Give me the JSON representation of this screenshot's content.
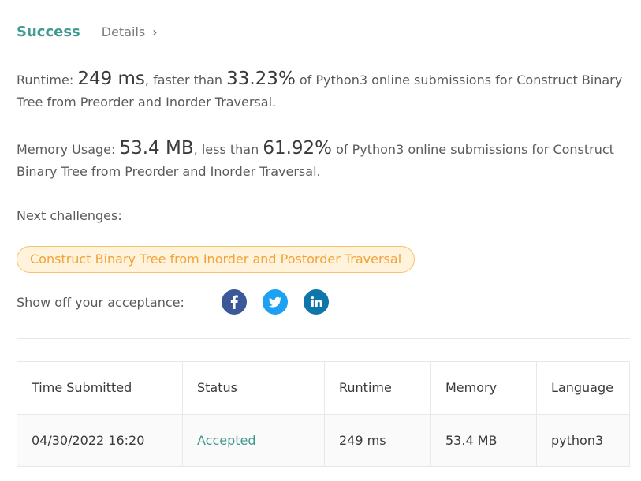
{
  "header": {
    "status": "Success",
    "details_label": "Details",
    "details_chevron": "›"
  },
  "runtime": {
    "label": "Runtime: ",
    "value": "249 ms",
    "comparison_text": ", faster than ",
    "percentile": "33.23%",
    "suffix": " of Python3 online submissions for Construct Binary Tree from Preorder and Inorder Traversal."
  },
  "memory": {
    "label": "Memory Usage: ",
    "value": "53.4 MB",
    "comparison_text": ", less than ",
    "percentile": "61.92%",
    "suffix": " of Python3 online submissions for Construct Binary Tree from Preorder and Inorder Traversal."
  },
  "next_challenges": {
    "label": "Next challenges:",
    "items": [
      "Construct Binary Tree from Inorder and Postorder Traversal"
    ]
  },
  "share": {
    "label": "Show off your acceptance:",
    "icons": [
      {
        "name": "facebook-icon",
        "color": "#3b5998",
        "glyph": "f"
      },
      {
        "name": "twitter-icon",
        "color": "#1da1f2"
      },
      {
        "name": "linkedin-icon",
        "color": "#0e76a8",
        "glyph": "in"
      }
    ]
  },
  "submissions": {
    "columns": [
      "Time Submitted",
      "Status",
      "Runtime",
      "Memory",
      "Language"
    ],
    "rows": [
      {
        "time": "04/30/2022 16:20",
        "status": "Accepted",
        "runtime": "249 ms",
        "memory": "53.4 MB",
        "language": "python3"
      }
    ]
  },
  "colors": {
    "accent_green": "#3f9a8f",
    "tag_orange": "#f2a23b",
    "tag_bg": "#fff3dc"
  }
}
